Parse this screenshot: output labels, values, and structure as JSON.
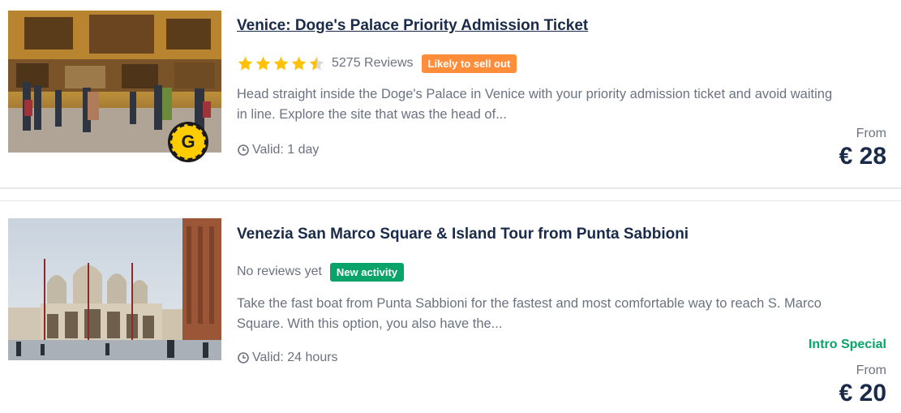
{
  "activities": [
    {
      "title": "Venice: Doge's Palace Priority Admission Ticket",
      "rating": 4.5,
      "reviews_text": "5275 Reviews",
      "tag": "Likely to sell out",
      "description": "Head straight inside the Doge's Palace in Venice with your priority admission ticket and avoid waiting in line. Explore the site that was the head of...",
      "valid_text": "Valid: 1 day",
      "from_label": "From",
      "price": "€ 28",
      "image_icon": "getyourguide-coin-badge",
      "badge_letter": "G"
    },
    {
      "title": "Venezia San Marco Square & Island Tour from Punta Sabbioni",
      "reviews_text": "No reviews yet",
      "tag": "New activity",
      "description": "Take the fast boat from Punta Sabbioni for the fastest and most comfortable way to reach S. Marco Square. With this option, you also have the...",
      "valid_text": "Valid: 24 hours",
      "intro_label": "Intro Special",
      "from_label": "From",
      "price": "€ 20"
    }
  ],
  "colors": {
    "title": "#1a2b49",
    "star": "#ffc107",
    "tag_orange": "#ff8d3a",
    "tag_green": "#0aa36a",
    "muted_text": "#6b7280"
  }
}
